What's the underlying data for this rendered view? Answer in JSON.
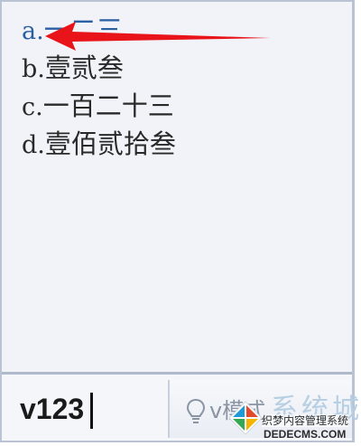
{
  "candidates": [
    {
      "key": "a.",
      "text": "一二三"
    },
    {
      "key": "b.",
      "text": "壹贰叁"
    },
    {
      "key": "c.",
      "text": "一百二十三"
    },
    {
      "key": "d.",
      "text": "壹佰贰拾叁"
    }
  ],
  "input": {
    "value": "v123"
  },
  "toolbar": {
    "mode_label": "v模式",
    "mode_icon": "lightbulb-icon"
  },
  "watermark": {
    "big_text": "系统城",
    "line1": "织梦内容管理系统",
    "line2": "DEDECMS.COM",
    "logo_icon": "windows-logo-icon"
  },
  "colors": {
    "selected_candidate": "#2b5fa3",
    "annotation_arrow": "#e8141a",
    "panel_background": "#f1f3f8",
    "border": "#b9c3d3"
  }
}
